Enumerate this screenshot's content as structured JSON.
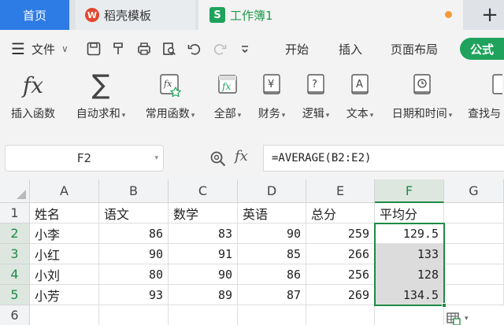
{
  "tabs": {
    "home": "首页",
    "templates": "稻壳模板",
    "templates_logo": "W",
    "workbook": "工作簿1",
    "workbook_icon": "S",
    "new_tab": "+"
  },
  "menu": {
    "file": "文件",
    "items": [
      "开始",
      "插入",
      "页面布局",
      "公式"
    ],
    "active": "公式"
  },
  "ribbon": [
    {
      "label": "插入函数",
      "icon": "fx-icon",
      "dropdown": false
    },
    {
      "label": "自动求和",
      "icon": "sigma-icon",
      "dropdown": true
    },
    {
      "label": "常用函数",
      "icon": "star-fx-icon",
      "dropdown": true
    },
    {
      "label": "全部",
      "icon": "fx-box-icon",
      "dropdown": true
    },
    {
      "label": "财务",
      "icon": "yen-book-icon",
      "dropdown": true
    },
    {
      "label": "逻辑",
      "icon": "question-book-icon",
      "dropdown": true
    },
    {
      "label": "文本",
      "icon": "a-book-icon",
      "dropdown": true
    },
    {
      "label": "日期和时间",
      "icon": "clock-book-icon",
      "dropdown": true
    },
    {
      "label": "查找与",
      "icon": "lookup-book-icon",
      "dropdown": false
    }
  ],
  "formula_bar": {
    "name_box": "F2",
    "fx": "fx",
    "formula": "=AVERAGE(B2:E2)"
  },
  "sheet": {
    "columns": [
      "A",
      "B",
      "C",
      "D",
      "E",
      "F",
      "G"
    ],
    "selected_column": "F",
    "rows": [
      "1",
      "2",
      "3",
      "4",
      "5",
      "6"
    ],
    "header": [
      "姓名",
      "语文",
      "数学",
      "英语",
      "总分",
      "平均分"
    ],
    "data": [
      [
        "小李",
        "86",
        "83",
        "90",
        "259",
        "129.5"
      ],
      [
        "小红",
        "90",
        "91",
        "85",
        "266",
        "133"
      ],
      [
        "小刘",
        "80",
        "90",
        "86",
        "256",
        "128"
      ],
      [
        "小芳",
        "93",
        "89",
        "87",
        "269",
        "134.5"
      ]
    ]
  },
  "colors": {
    "accent_green": "#1e8a45",
    "home_blue": "#2d7be5",
    "formula_tab": "#1fa35c",
    "unsaved_dot": "#f29a38"
  }
}
